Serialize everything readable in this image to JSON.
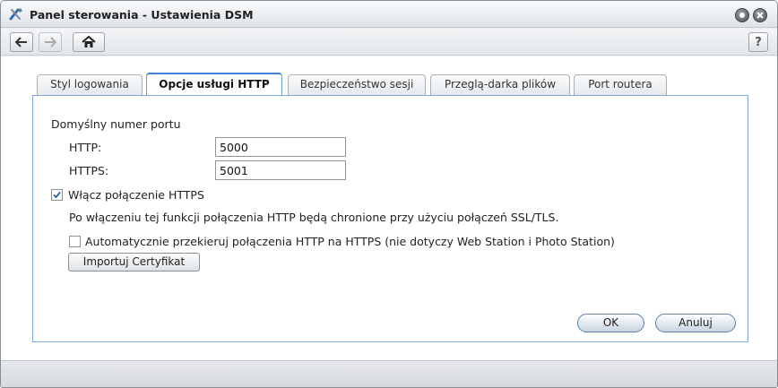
{
  "window": {
    "title": "Panel sterowania - Ustawienia DSM"
  },
  "toolbar": {
    "help_label": "?"
  },
  "tabs": [
    {
      "label": "Styl logowania",
      "active": false
    },
    {
      "label": "Opcje usługi HTTP",
      "active": true
    },
    {
      "label": "Bezpieczeństwo sesji",
      "active": false
    },
    {
      "label": "Przeglą-darka plików",
      "active": false
    },
    {
      "label": "Port routera",
      "active": false
    }
  ],
  "form": {
    "section_label": "Domyślny numer portu",
    "http_label": "HTTP:",
    "http_value": "5000",
    "https_label": "HTTPS:",
    "https_value": "5001",
    "enable_https_label": "Włącz połączenie HTTPS",
    "enable_https_checked": true,
    "https_note": "Po włączeniu tej funkcji połączenia HTTP będą chronione przy użyciu połączeń SSL/TLS.",
    "redirect_label": "Automatycznie przekieruj połączenia HTTP na HTTPS (nie dotyczy Web Station i Photo Station)",
    "redirect_checked": false,
    "import_cert_label": "Importuj Certyfikat"
  },
  "actions": {
    "ok_label": "OK",
    "cancel_label": "Anuluj"
  },
  "colors": {
    "accent": "#3f86d4",
    "panel_border": "#7fa9d9"
  }
}
